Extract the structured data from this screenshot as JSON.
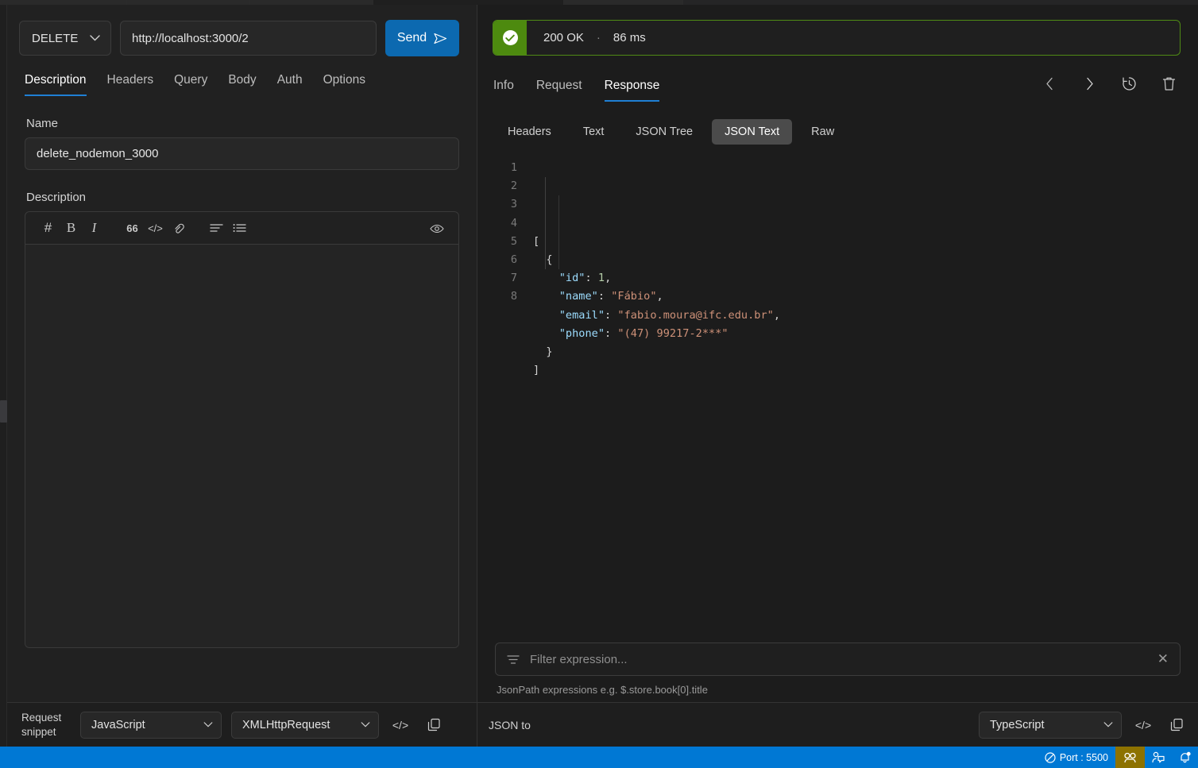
{
  "request": {
    "method": "DELETE",
    "url": "http://localhost:3000/2",
    "send_label": "Send",
    "tabs": [
      {
        "label": "Description",
        "active": true
      },
      {
        "label": "Headers",
        "active": false
      },
      {
        "label": "Query",
        "active": false
      },
      {
        "label": "Body",
        "active": false
      },
      {
        "label": "Auth",
        "active": false
      },
      {
        "label": "Options",
        "active": false
      }
    ],
    "name_label": "Name",
    "name_value": "delete_nodemon_3000",
    "description_label": "Description",
    "description_value": "",
    "editor_toolbar": [
      {
        "name": "heading-icon",
        "glyph": "#"
      },
      {
        "name": "bold-icon",
        "glyph": "B"
      },
      {
        "name": "italic-icon",
        "glyph": "I"
      },
      {
        "name": "quote-icon",
        "glyph": "66"
      },
      {
        "name": "code-icon",
        "glyph": "</>"
      },
      {
        "name": "link-icon",
        "glyph": "link"
      },
      {
        "name": "unordered-list-icon",
        "glyph": "ul"
      },
      {
        "name": "ordered-list-icon",
        "glyph": "ol"
      },
      {
        "name": "preview-eye-icon",
        "glyph": "eye"
      }
    ]
  },
  "snippet": {
    "label_line1": "Request",
    "label_line2": "snippet",
    "language": "JavaScript",
    "client": "XMLHttpRequest"
  },
  "response": {
    "status_code": "200 OK",
    "separator": "·",
    "time": "86 ms",
    "status_color": "#4d8a0f",
    "tabs": [
      {
        "label": "Info",
        "active": false
      },
      {
        "label": "Request",
        "active": false
      },
      {
        "label": "Response",
        "active": true
      }
    ],
    "actions": [
      {
        "name": "prev-response-icon"
      },
      {
        "name": "next-response-icon"
      },
      {
        "name": "history-icon"
      },
      {
        "name": "delete-response-icon"
      }
    ],
    "subtabs": [
      {
        "label": "Headers",
        "active": false
      },
      {
        "label": "Text",
        "active": false
      },
      {
        "label": "JSON Tree",
        "active": false
      },
      {
        "label": "JSON Text",
        "active": true
      },
      {
        "label": "Raw",
        "active": false
      }
    ],
    "code_lines": [
      {
        "num": "1",
        "tokens": [
          {
            "t": "punc",
            "v": "["
          }
        ]
      },
      {
        "num": "2",
        "tokens": [
          {
            "t": "punc",
            "v": "  {"
          }
        ]
      },
      {
        "num": "3",
        "tokens": [
          {
            "t": "punc",
            "v": "    "
          },
          {
            "t": "key",
            "v": "\"id\""
          },
          {
            "t": "punc",
            "v": ": "
          },
          {
            "t": "num",
            "v": "1"
          },
          {
            "t": "punc",
            "v": ","
          }
        ]
      },
      {
        "num": "4",
        "tokens": [
          {
            "t": "punc",
            "v": "    "
          },
          {
            "t": "key",
            "v": "\"name\""
          },
          {
            "t": "punc",
            "v": ": "
          },
          {
            "t": "str",
            "v": "\"Fábio\""
          },
          {
            "t": "punc",
            "v": ","
          }
        ]
      },
      {
        "num": "5",
        "tokens": [
          {
            "t": "punc",
            "v": "    "
          },
          {
            "t": "key",
            "v": "\"email\""
          },
          {
            "t": "punc",
            "v": ": "
          },
          {
            "t": "str",
            "v": "\"fabio.moura@ifc.edu.br\""
          },
          {
            "t": "punc",
            "v": ","
          }
        ]
      },
      {
        "num": "6",
        "tokens": [
          {
            "t": "punc",
            "v": "    "
          },
          {
            "t": "key",
            "v": "\"phone\""
          },
          {
            "t": "punc",
            "v": ": "
          },
          {
            "t": "str",
            "v": "\"(47) 99217-2***\""
          }
        ]
      },
      {
        "num": "7",
        "tokens": [
          {
            "t": "punc",
            "v": "  }"
          }
        ]
      },
      {
        "num": "8",
        "tokens": [
          {
            "t": "punc",
            "v": "]"
          }
        ]
      }
    ],
    "filter_placeholder": "Filter expression...",
    "filter_value": "",
    "filter_hint": "JsonPath expressions e.g. $.store.book[0].title"
  },
  "json_to": {
    "label": "JSON to",
    "target": "TypeScript"
  },
  "status_bar": {
    "port": "Port : 5500",
    "accent": "#0078d4",
    "gold": "#8d7200",
    "items": [
      {
        "name": "port-status",
        "label": "Port : 5500"
      },
      {
        "name": "live-share-icon",
        "label": ""
      },
      {
        "name": "feedback-icon",
        "label": ""
      },
      {
        "name": "notifications-bell-icon",
        "label": ""
      }
    ]
  }
}
